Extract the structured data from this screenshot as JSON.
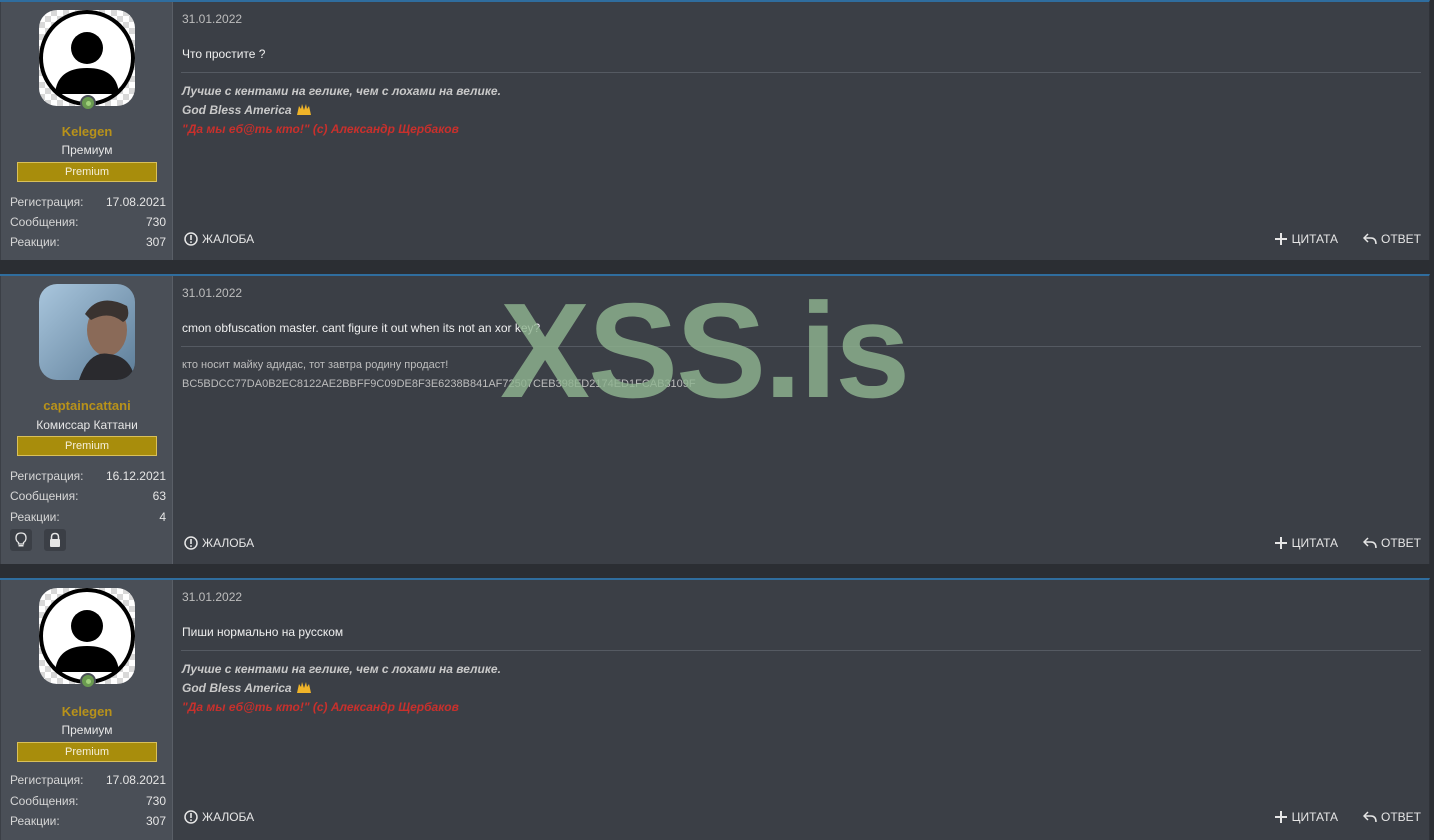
{
  "watermark": "XSS.is",
  "labels": {
    "reg": "Регистрация:",
    "msgs": "Сообщения:",
    "reacts": "Реакции:",
    "report": "ЖАЛОБА",
    "quote": "ЦИТАТА",
    "reply": "ОТВЕТ"
  },
  "posts": [
    {
      "username": "Kelegen",
      "user_title": "Премиум",
      "badge": "Premium",
      "reg": "17.08.2021",
      "messages": "730",
      "reactions": "307",
      "date": "31.01.2022",
      "message": "Что простите ?",
      "sig1": "Лучше с кентами на гелике, чем с лохами на велике.",
      "sig2": "God Bless America",
      "sig3": "\"Да мы еб@ть кто!\" (c) Александр Щербаков"
    },
    {
      "username": "captaincattani",
      "user_title": "Комиссар Каттани",
      "badge": "Premium",
      "reg": "16.12.2021",
      "messages": "63",
      "reactions": "4",
      "date": "31.01.2022",
      "message": "cmon obfuscation master. cant figure it out when its not an xor key?",
      "sig1": "кто носит майку адидас, тот завтра родину продаст!",
      "sig2": "BC5BDCC77DA0B2EC8122AE2BBFF9C09DE8F3E6238B841AF72507CEB398ED2174ED1FCAB3109F"
    },
    {
      "username": "Kelegen",
      "user_title": "Премиум",
      "badge": "Premium",
      "reg": "17.08.2021",
      "messages": "730",
      "reactions": "307",
      "date": "31.01.2022",
      "message": "Пиши нормально на русском",
      "sig1": "Лучше с кентами на гелике, чем с лохами на велике.",
      "sig2": "God Bless America",
      "sig3": "\"Да мы еб@ть кто!\" (c) Александр Щербаков"
    }
  ]
}
